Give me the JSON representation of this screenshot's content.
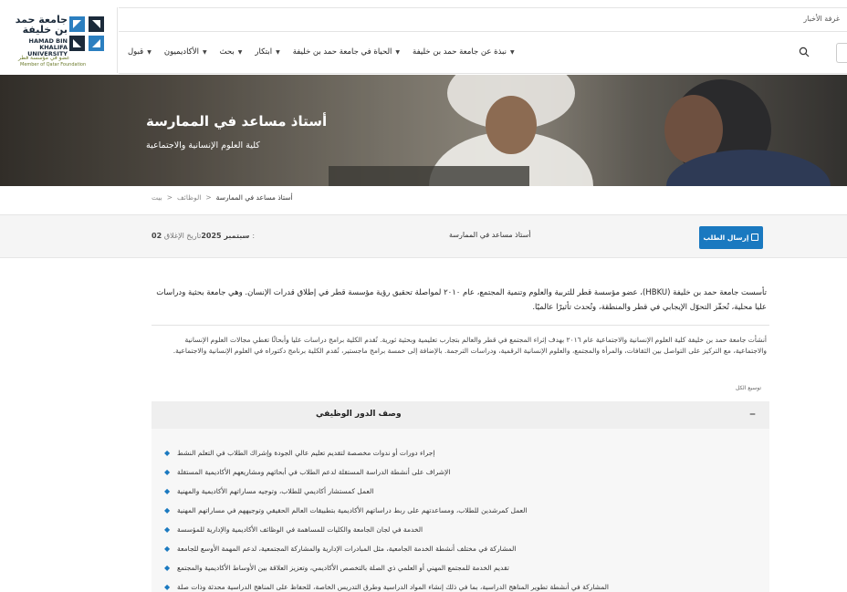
{
  "brand": {
    "logo_ar": "جامعة حمد بن خليفة",
    "logo_en_1": "HAMAD BIN KHALIFA",
    "logo_en_2": "UNIVERSITY",
    "member_ar": "عضو في مؤسسة قطر",
    "member_en": "Member of Qatar Foundation"
  },
  "topbar": {
    "newsroom": "غرفة الأخبار"
  },
  "nav": {
    "items": [
      {
        "label": "نبذة عن جامعة حمد بن خليفة"
      },
      {
        "label": "الحياة في جامعة حمد بن خليفة"
      },
      {
        "label": "ابتكار"
      },
      {
        "label": "بحث"
      },
      {
        "label": "الأكاديميون"
      },
      {
        "label": "قبول"
      }
    ],
    "search_icon": "search-icon"
  },
  "hero": {
    "title": "أستاذ مساعد في الممارسة",
    "subtitle": "كلية العلوم الإنسانية والاجتماعية"
  },
  "breadcrumb": {
    "home": "بيت",
    "jobs": "الوظائف",
    "current": "أستاذ مساعد في الممارسة",
    "sep": ">"
  },
  "infobar": {
    "closing_date_label": "تاريخ الإغلاق:",
    "closing_date_value": "02 سبتمبر 2025",
    "job_title": "أستاذ مساعد في الممارسة",
    "apply_label": "إرسال الطلب"
  },
  "intro": "تأسست جامعة حمد بن خليفة (HBKU)، عضو مؤسسة قطر للتربية والعلوم وتنمية المجتمع، عام ٢٠١٠ لمواصلة تحقيق رؤية مؤسسة قطر في إطلاق قدرات الإنسان. وهي جامعة بحثية ودراسات عليا محلية، تُحفّز التحوّل الإيجابي في قطر والمنطقة، وتُحدث تأثيرًا عالميًا.",
  "about": "أنشأت جامعة حمد بن خليفة كلية العلوم الإنسانية والاجتماعية عام ٢٠١٦ بهدف إثراء المجتمع في قطر والعالم بتجارب تعليمية وبحثية ثورية. تُقدم الكلية برامج دراسات عليا وأبحاثًا تغطي مجالات العلوم الإنسانية والاجتماعية، مع التركيز على التواصل بين الثقافات، والمرأة والمجتمع، والعلوم الإنسانية الرقمية، ودراسات الترجمة. بالإضافة إلى خمسة برامج ماجستير، تُقدم الكلية برنامج دكتوراه في العلوم الإنسانية والاجتماعية.",
  "expand_all": "توسيع الكل",
  "accordion": {
    "title": "وصف الدور الوظيفي",
    "duties": [
      "إجراء دورات أو ندوات مخصصة لتقديم تعليم عالي الجودة وإشراك الطلاب في التعلم النشط",
      "الإشراف على أنشطة الدراسة المستقلة لدعم الطلاب في أبحاثهم ومشاريعهم الأكاديمية المستقلة",
      "العمل كمستشار أكاديمي للطلاب، وتوجيه مساراتهم الأكاديمية والمهنية",
      "العمل كمرشدين للطلاب، ومساعدتهم على ربط دراساتهم الأكاديمية بتطبيقات العالم الحقيقي وتوجيههم في مساراتهم المهنية",
      "الخدمة في لجان الجامعة والكليات للمساهمة في الوظائف الأكاديمية والإدارية للمؤسسة",
      "المشاركة في مختلف أنشطة الخدمة الجامعية، مثل المبادرات الإدارية والمشاركة المجتمعية، لدعم المهمة الأوسع للجامعة",
      "تقديم الخدمة للمجتمع المهني أو العلمي ذي الصلة بالتخصص الأكاديمي، وتعزيز العلاقة بين الأوساط الأكاديمية والمجتمع",
      "المشاركة في أنشطة تطوير المناهج الدراسية، بما في ذلك إنشاء المواد الدراسية وطرق التدريس الخاصة، للحفاظ على المناهج الدراسية محدثة وذات صلة"
    ]
  },
  "colors": {
    "accent": "#1a79c0",
    "logo_blue": "#2b7fc0"
  }
}
